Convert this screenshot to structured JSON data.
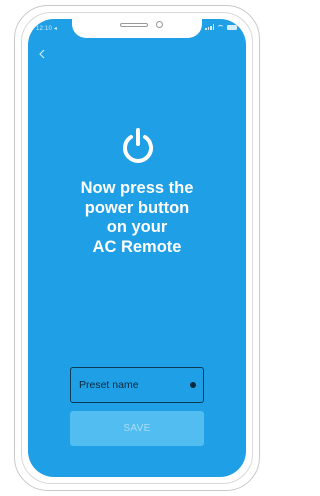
{
  "status_bar": {
    "time": "12:10 ◂"
  },
  "header": {
    "back_icon": "chevron-left-icon"
  },
  "main": {
    "power_icon": "power-icon",
    "headline_lines": [
      "Now press the",
      "power button",
      "on your",
      "AC Remote"
    ]
  },
  "form": {
    "preset_placeholder": "Preset name",
    "save_label": "SAVE"
  },
  "colors": {
    "screen_background": "#1f9fe6",
    "save_button": "#52bdf0",
    "text_on_screen": "#ffffff"
  }
}
